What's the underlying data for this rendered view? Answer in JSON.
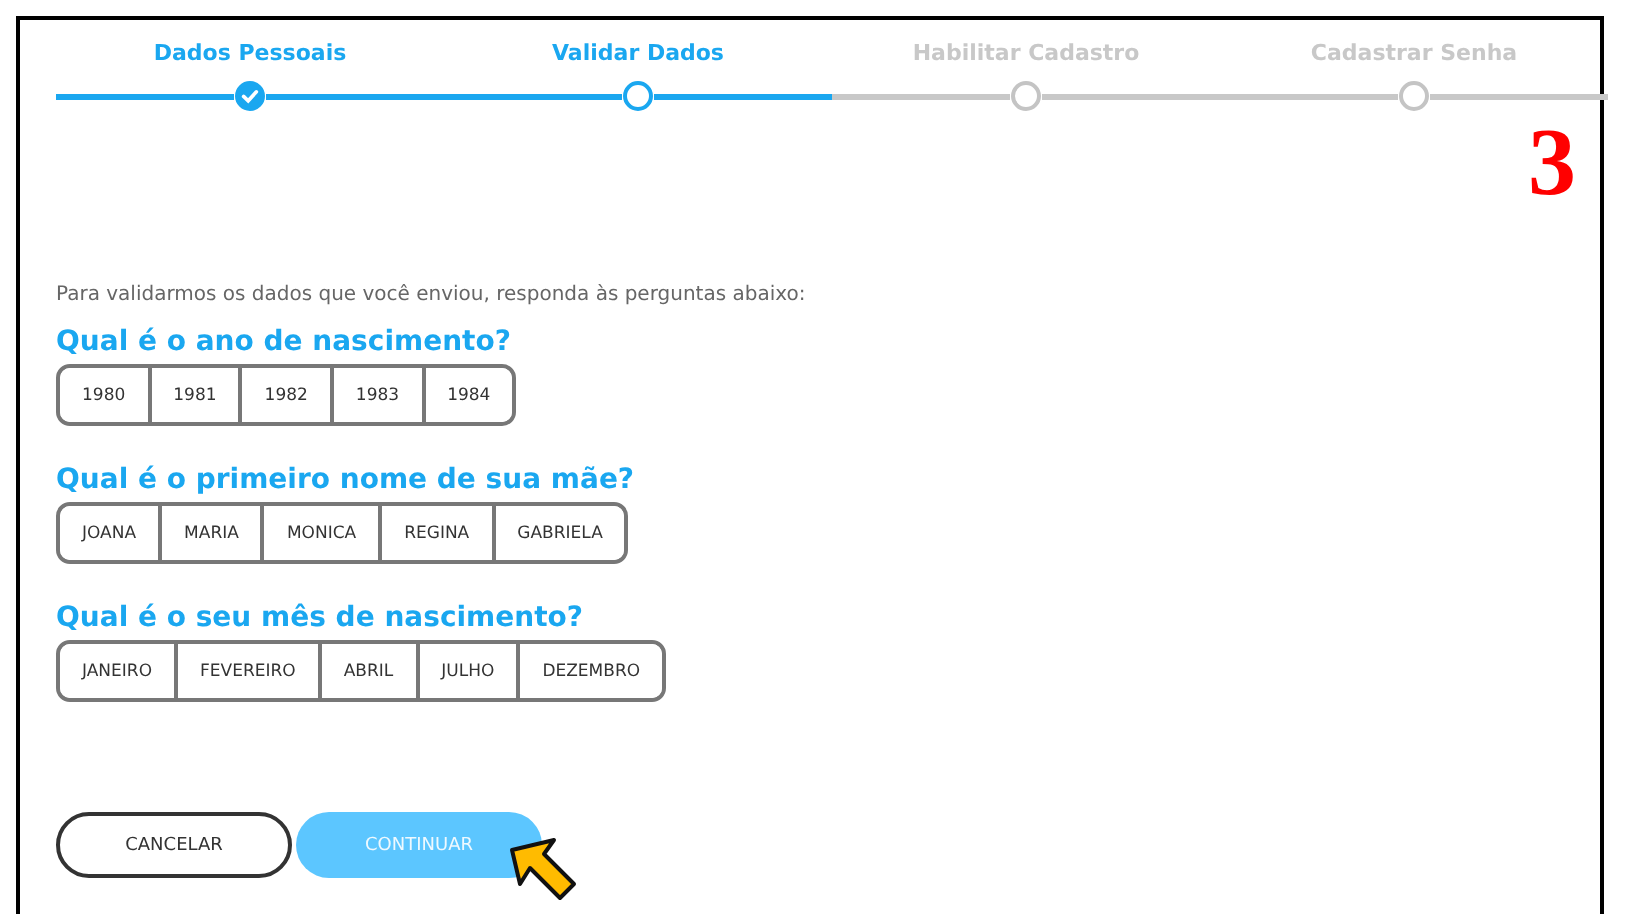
{
  "steps": [
    {
      "label": "Dados Pessoais",
      "completed": true,
      "current": false
    },
    {
      "label": "Validar Dados",
      "completed": false,
      "current": true
    },
    {
      "label": "Habilitar Cadastro",
      "completed": false,
      "current": false
    },
    {
      "label": "Cadastrar Senha",
      "completed": false,
      "current": false
    }
  ],
  "annotation_number": "3",
  "intro": "Para validarmos os dados que você enviou, responda às perguntas abaixo:",
  "questions": [
    {
      "title": "Qual é o ano de nascimento?",
      "options": [
        {
          "label": "1980",
          "selected": false
        },
        {
          "label": "1981",
          "selected": false
        },
        {
          "label": "1982",
          "selected": false
        },
        {
          "label": "1983",
          "selected": false
        },
        {
          "label": "1984",
          "selected": false
        }
      ]
    },
    {
      "title": "Qual é o primeiro nome de sua mãe?",
      "options": [
        {
          "label": "JOANA",
          "selected": false
        },
        {
          "label": "MARIA",
          "selected": false
        },
        {
          "label": "MONICA",
          "selected": false
        },
        {
          "label": "REGINA",
          "selected": false
        },
        {
          "label": "GABRIELA",
          "selected": false
        }
      ]
    },
    {
      "title": "Qual é o seu mês de nascimento?",
      "options": [
        {
          "label": "JANEIRO",
          "selected": false
        },
        {
          "label": "FEVEREIRO",
          "selected": false
        },
        {
          "label": "ABRIL",
          "selected": false
        },
        {
          "label": "JULHO",
          "selected": false
        },
        {
          "label": "DEZEMBRO",
          "selected": false
        }
      ]
    }
  ],
  "buttons": [
    {
      "label": "CANCELAR",
      "kind": "outline"
    },
    {
      "label": "CONTINUAR",
      "kind": "primary"
    }
  ]
}
